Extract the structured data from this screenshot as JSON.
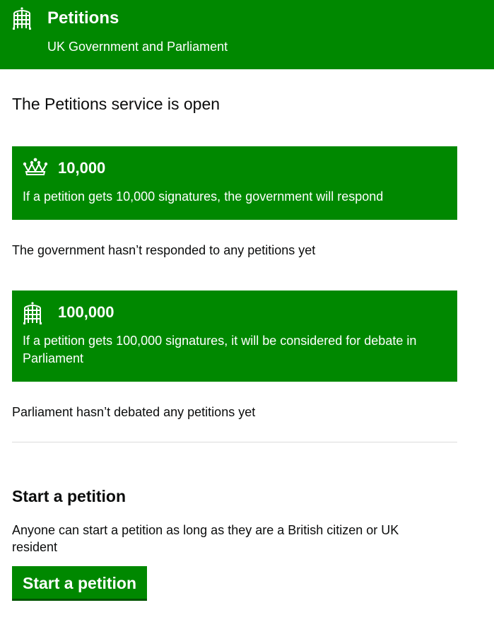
{
  "header": {
    "title": "Petitions",
    "subtitle": "UK Government and Parliament",
    "logo_icon": "portcullis-icon",
    "color": "#008800"
  },
  "status": "The Petitions service is open",
  "thresholds": [
    {
      "icon": "crown-icon",
      "count": "10,000",
      "description": "If a petition gets 10,000 signatures, the government will respond",
      "note": "The government hasn’t responded to any petitions yet"
    },
    {
      "icon": "portcullis-icon",
      "count": "100,000",
      "description": "If a petition gets 100,000 signatures, it will be considered for debate in Parliament",
      "note": "Parliament hasn’t debated any petitions yet"
    }
  ],
  "start": {
    "heading": "Start a petition",
    "text": "Anyone can start a petition as long as they are a British citizen or UK resident",
    "button_label": "Start a petition"
  },
  "colors": {
    "brand_green": "#008800",
    "button_shadow": "#005300",
    "text": "#0b0c0c"
  }
}
